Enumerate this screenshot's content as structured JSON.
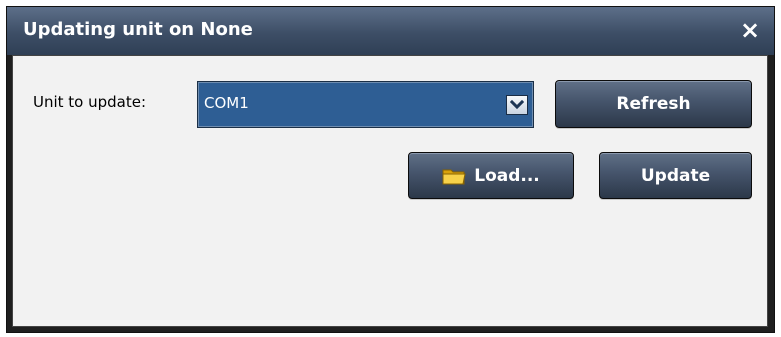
{
  "window": {
    "title": "Updating unit on None",
    "close_glyph": "×"
  },
  "form": {
    "unit_label": "Unit to update:",
    "unit_selected": "COM1",
    "refresh_label": "Refresh",
    "load_label": "Load...",
    "update_label": "Update"
  },
  "icons": {
    "close": "close-icon",
    "dropdown": "chevron-down-icon",
    "folder": "folder-icon"
  },
  "colors": {
    "titlebar": "#3d4e66",
    "combo_background": "#2e5e94",
    "button": "#45546b",
    "client_background": "#f2f2f2",
    "folder": "#f1c232"
  }
}
